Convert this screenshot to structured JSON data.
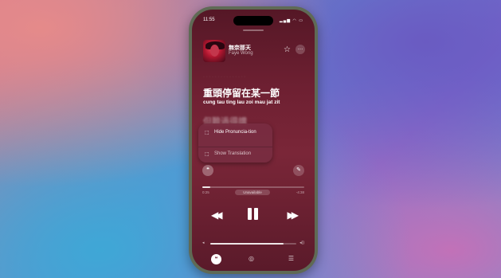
{
  "status": {
    "time": "11:55",
    "icons": "▂▄▆ ◠ ▭"
  },
  "now_playing": {
    "title": "無奈那天",
    "artist": "Faye Wong",
    "star_icon": "star-icon",
    "more_icon": "more-icon"
  },
  "lyrics": {
    "main": "重頭停留在某一節",
    "pronunciation": "cung tau ting lau zoi mau jat zit",
    "next": "但難過得講"
  },
  "menu": {
    "items": [
      {
        "label": "Hide Pronuncia-tion",
        "icon": "lyrics-pron-icon"
      },
      {
        "label": "Show Translation",
        "icon": "translation-icon"
      }
    ]
  },
  "playback": {
    "elapsed": "0:25",
    "remaining": "-4:38",
    "progress_fraction": 0.08,
    "badge": "Unavailable",
    "volume_fraction": 0.85
  },
  "colors": {
    "accent": "#6e2032"
  }
}
